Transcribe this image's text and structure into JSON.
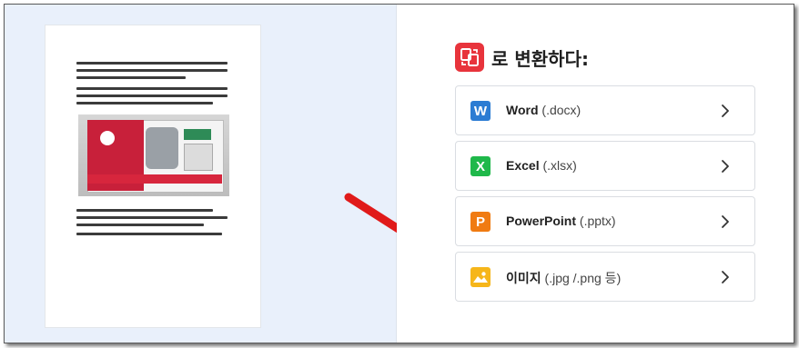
{
  "convert": {
    "title": "로 변환하다:"
  },
  "options": [
    {
      "name": "Word",
      "ext": "(.docx)",
      "icon_letter": "W",
      "color": "#2b7cd3"
    },
    {
      "name": "Excel",
      "ext": "(.xlsx)",
      "icon_letter": "X",
      "color": "#1fb84a"
    },
    {
      "name": "PowerPoint",
      "ext": "(.pptx)",
      "icon_letter": "P",
      "color": "#f07b12"
    },
    {
      "name": "이미지",
      "ext": "(.jpg /.png 등)",
      "icon_letter": "",
      "color": "#f6b61a"
    }
  ],
  "colors": {
    "accent_red": "#e8343c",
    "arrow_red": "#e01a1a",
    "left_bg": "#e9f0fb"
  },
  "icons": {
    "convert": "convert-icon",
    "chevron": "chevron-right-icon",
    "image": "image-icon"
  }
}
